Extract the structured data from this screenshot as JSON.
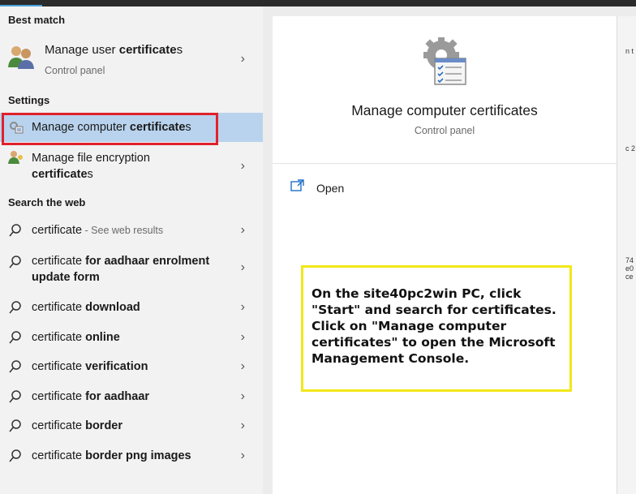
{
  "sections": {
    "best_match": "Best match",
    "settings": "Settings",
    "search_web": "Search the web"
  },
  "best_match": {
    "title_plain": "Manage user ",
    "title_bold": "certificate",
    "title_tail": "s",
    "subtitle": "Control panel"
  },
  "settings_items": [
    {
      "plain": "Manage computer ",
      "bold": "certificate",
      "tail": "s"
    },
    {
      "line1": "Manage file encryption",
      "bold": "certificate",
      "tail": "s"
    }
  ],
  "web_items": [
    {
      "plain": "certificate",
      "rest": "",
      "hint": " - See web results"
    },
    {
      "plain": "certificate",
      "rest": " for aadhaar enrolment",
      "line2": "update form"
    },
    {
      "plain": "certificate",
      "rest": " download"
    },
    {
      "plain": "certificate",
      "rest": " online"
    },
    {
      "plain": "certificate",
      "rest": " verification"
    },
    {
      "plain": "certificate",
      "rest": " for aadhaar"
    },
    {
      "plain": "certificate",
      "rest": " border"
    },
    {
      "plain": "certificate",
      "rest": " border png images"
    }
  ],
  "preview": {
    "title": "Manage computer certificates",
    "subtitle": "Control panel",
    "open_label": "Open"
  },
  "annotation": "On the site40pc2win PC, click \"Start\" and search for certificates.  Click on \"Manage computer certificates\" to open the Microsoft Management Console.",
  "edge_fragments": [
    "n t",
    "c 2",
    "74",
    "e0",
    "ce"
  ],
  "colors": {
    "selection": "#b9d3ee",
    "highlight_border": "#e0222c",
    "annotation_border": "#f2e81a"
  }
}
